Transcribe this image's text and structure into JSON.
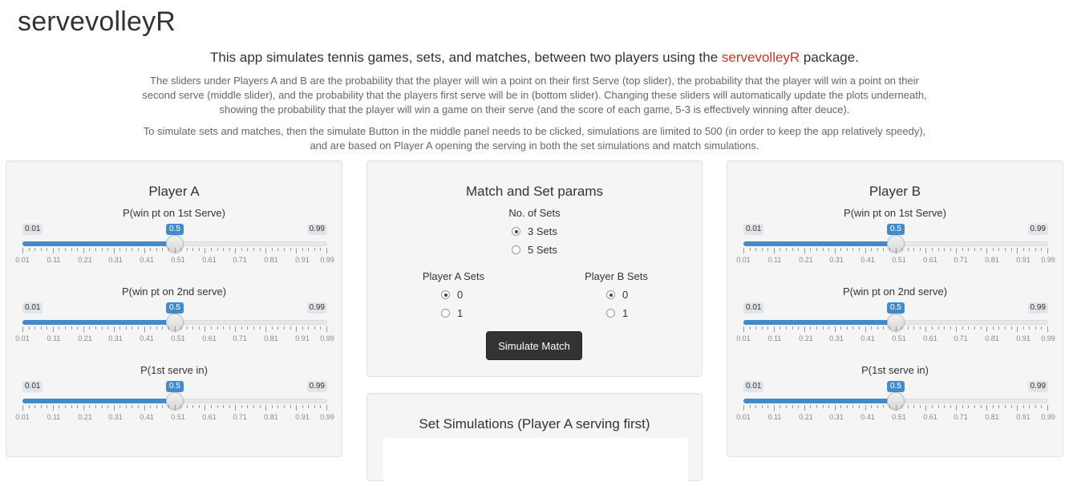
{
  "app": {
    "title": "servevolleyR"
  },
  "intro": {
    "lead_prefix": "This app simulates tennis games, sets, and matches, between two players using the ",
    "lead_pkg": "servevolleyR",
    "lead_suffix": " package.",
    "para1": "The sliders under Players A and B are the probability that the player will win a point on their first Serve (top slider), the probability that the player will win a point on their second serve (middle slider), and the probability that the players first serve will be in (bottom slider). Changing these sliders will automatically update the plots underneath, showing the probability that the player will win a game on their serve (and the score of each game, 5-3 is effectively winning after deuce).",
    "para2": "To simulate sets and matches, then the simulate Button in the middle panel needs to be clicked, simulations are limited to 500 (in order to keep the app relatively speedy), and are based on Player A opening the serving in both the set simulations and match simulations."
  },
  "tick_labels": [
    "0.01",
    "0.11",
    "0.21",
    "0.31",
    "0.41",
    "0.51",
    "0.61",
    "0.71",
    "0.81",
    "0.91",
    "0.99"
  ],
  "player_a": {
    "title": "Player A",
    "sliders": [
      {
        "label": "P(win pt on 1st Serve)",
        "min": "0.01",
        "max": "0.99",
        "value": "0.5"
      },
      {
        "label": "P(win pt on 2nd serve)",
        "min": "0.01",
        "max": "0.99",
        "value": "0.5"
      },
      {
        "label": "P(1st serve in)",
        "min": "0.01",
        "max": "0.99",
        "value": "0.5"
      }
    ]
  },
  "player_b": {
    "title": "Player B",
    "sliders": [
      {
        "label": "P(win pt on 1st Serve)",
        "min": "0.01",
        "max": "0.99",
        "value": "0.5"
      },
      {
        "label": "P(win pt on 2nd serve)",
        "min": "0.01",
        "max": "0.99",
        "value": "0.5"
      },
      {
        "label": "P(1st serve in)",
        "min": "0.01",
        "max": "0.99",
        "value": "0.5"
      }
    ]
  },
  "match_params": {
    "title": "Match and Set params",
    "sets_label": "No. of Sets",
    "sets_options": [
      {
        "label": "3 Sets",
        "checked": true
      },
      {
        "label": "5 Sets",
        "checked": false
      }
    ],
    "a_sets_label": "Player A Sets",
    "a_sets_options": [
      {
        "label": "0",
        "checked": true
      },
      {
        "label": "1",
        "checked": false
      }
    ],
    "b_sets_label": "Player B Sets",
    "b_sets_options": [
      {
        "label": "0",
        "checked": true
      },
      {
        "label": "1",
        "checked": false
      }
    ],
    "simulate_button": "Simulate Match"
  },
  "set_sim": {
    "title": "Set Simulations (Player A serving first)"
  }
}
